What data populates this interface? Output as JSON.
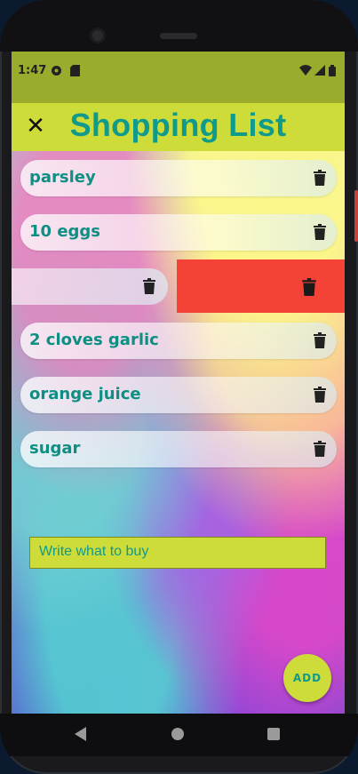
{
  "status_bar": {
    "time": "1:47",
    "icons": [
      "settings-circle-icon",
      "sd-card-icon",
      "wifi-icon",
      "signal-icon",
      "battery-icon"
    ]
  },
  "app_bar": {
    "title": "Shopping List",
    "close_icon": "close-icon"
  },
  "items": [
    {
      "label": "parsley"
    },
    {
      "label": "10 eggs"
    },
    {
      "label": ""
    },
    {
      "label": "2 cloves garlic"
    },
    {
      "label": "orange juice"
    },
    {
      "label": "sugar"
    }
  ],
  "input": {
    "placeholder": "Write what to buy"
  },
  "fab": {
    "label": "ADD"
  },
  "colors": {
    "accent": "#cddc39",
    "title_teal": "#0f9a8c",
    "delete_red": "#f44336",
    "statusbar": "#9aab2d"
  }
}
